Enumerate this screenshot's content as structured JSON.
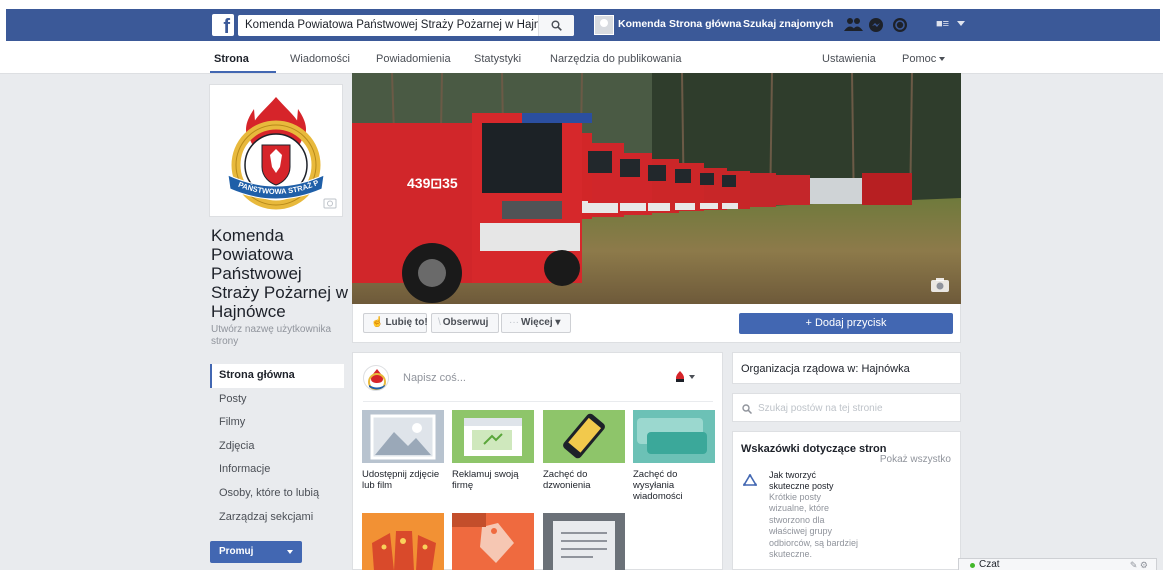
{
  "topbar": {
    "logo": "f",
    "search_value": "Komenda Powiatowa Państwowej Straży Pożarnej w Hajnówce",
    "user_name": "Komenda",
    "home_link": "Strona główna",
    "find_friends": "Szukaj znajomych",
    "icons": [
      "friend-requests-icon",
      "messages-icon",
      "notifications-icon",
      "privacy-shortcuts-icon",
      "account-menu-icon"
    ]
  },
  "page_tabs": {
    "items": [
      "Strona",
      "Wiadomości",
      "Powiadomienia",
      "Statystyki",
      "Narzędzia do publikowania"
    ],
    "right": [
      "Ustawienia",
      "Pomoc"
    ]
  },
  "profile": {
    "name": "Komenda Powiatowa Państwowej Straży Pożarnej w Hajnówce",
    "username_prompt": "Utwórz nazwę użytkownika strony",
    "logo_text": "PAŃSTWOWA STRAŻ POŻARNA",
    "truck_number": "439⊡35"
  },
  "left_nav": {
    "items": [
      "Strona główna",
      "Posty",
      "Filmy",
      "Zdjęcia",
      "Informacje",
      "Osoby, które to lubią",
      "Zarządzaj sekcjami"
    ],
    "promote": "Promuj"
  },
  "actions": {
    "like": "Lubię to!",
    "follow": "Obserwuj",
    "more": "Więcej",
    "add_button": "+ Dodaj przycisk"
  },
  "composer": {
    "placeholder": "Napisz coś...",
    "tiles": [
      "Udostępnij zdjęcie lub film",
      "Reklamuj swoją firmę",
      "Zachęć do dzwonienia",
      "Zachęć do wysyłania wiadomości"
    ]
  },
  "right": {
    "org": "Organizacja rządowa w: Hajnówka",
    "search_placeholder": "Szukaj postów na tej stronie",
    "tips_title": "Wskazówki dotyczące stron",
    "show_all": "Pokaż wszystko",
    "tip_title": "Jak tworzyć skuteczne posty",
    "tip_text": "Krótkie posty wizualne, które stworzono dla właściwej grupy odbiorców, są bardziej skuteczne."
  },
  "chat": {
    "label": "Czat"
  },
  "colors": {
    "facebook_blue": "#3b5998",
    "accent_blue": "#4267b2",
    "fire_red": "#d6242a"
  }
}
